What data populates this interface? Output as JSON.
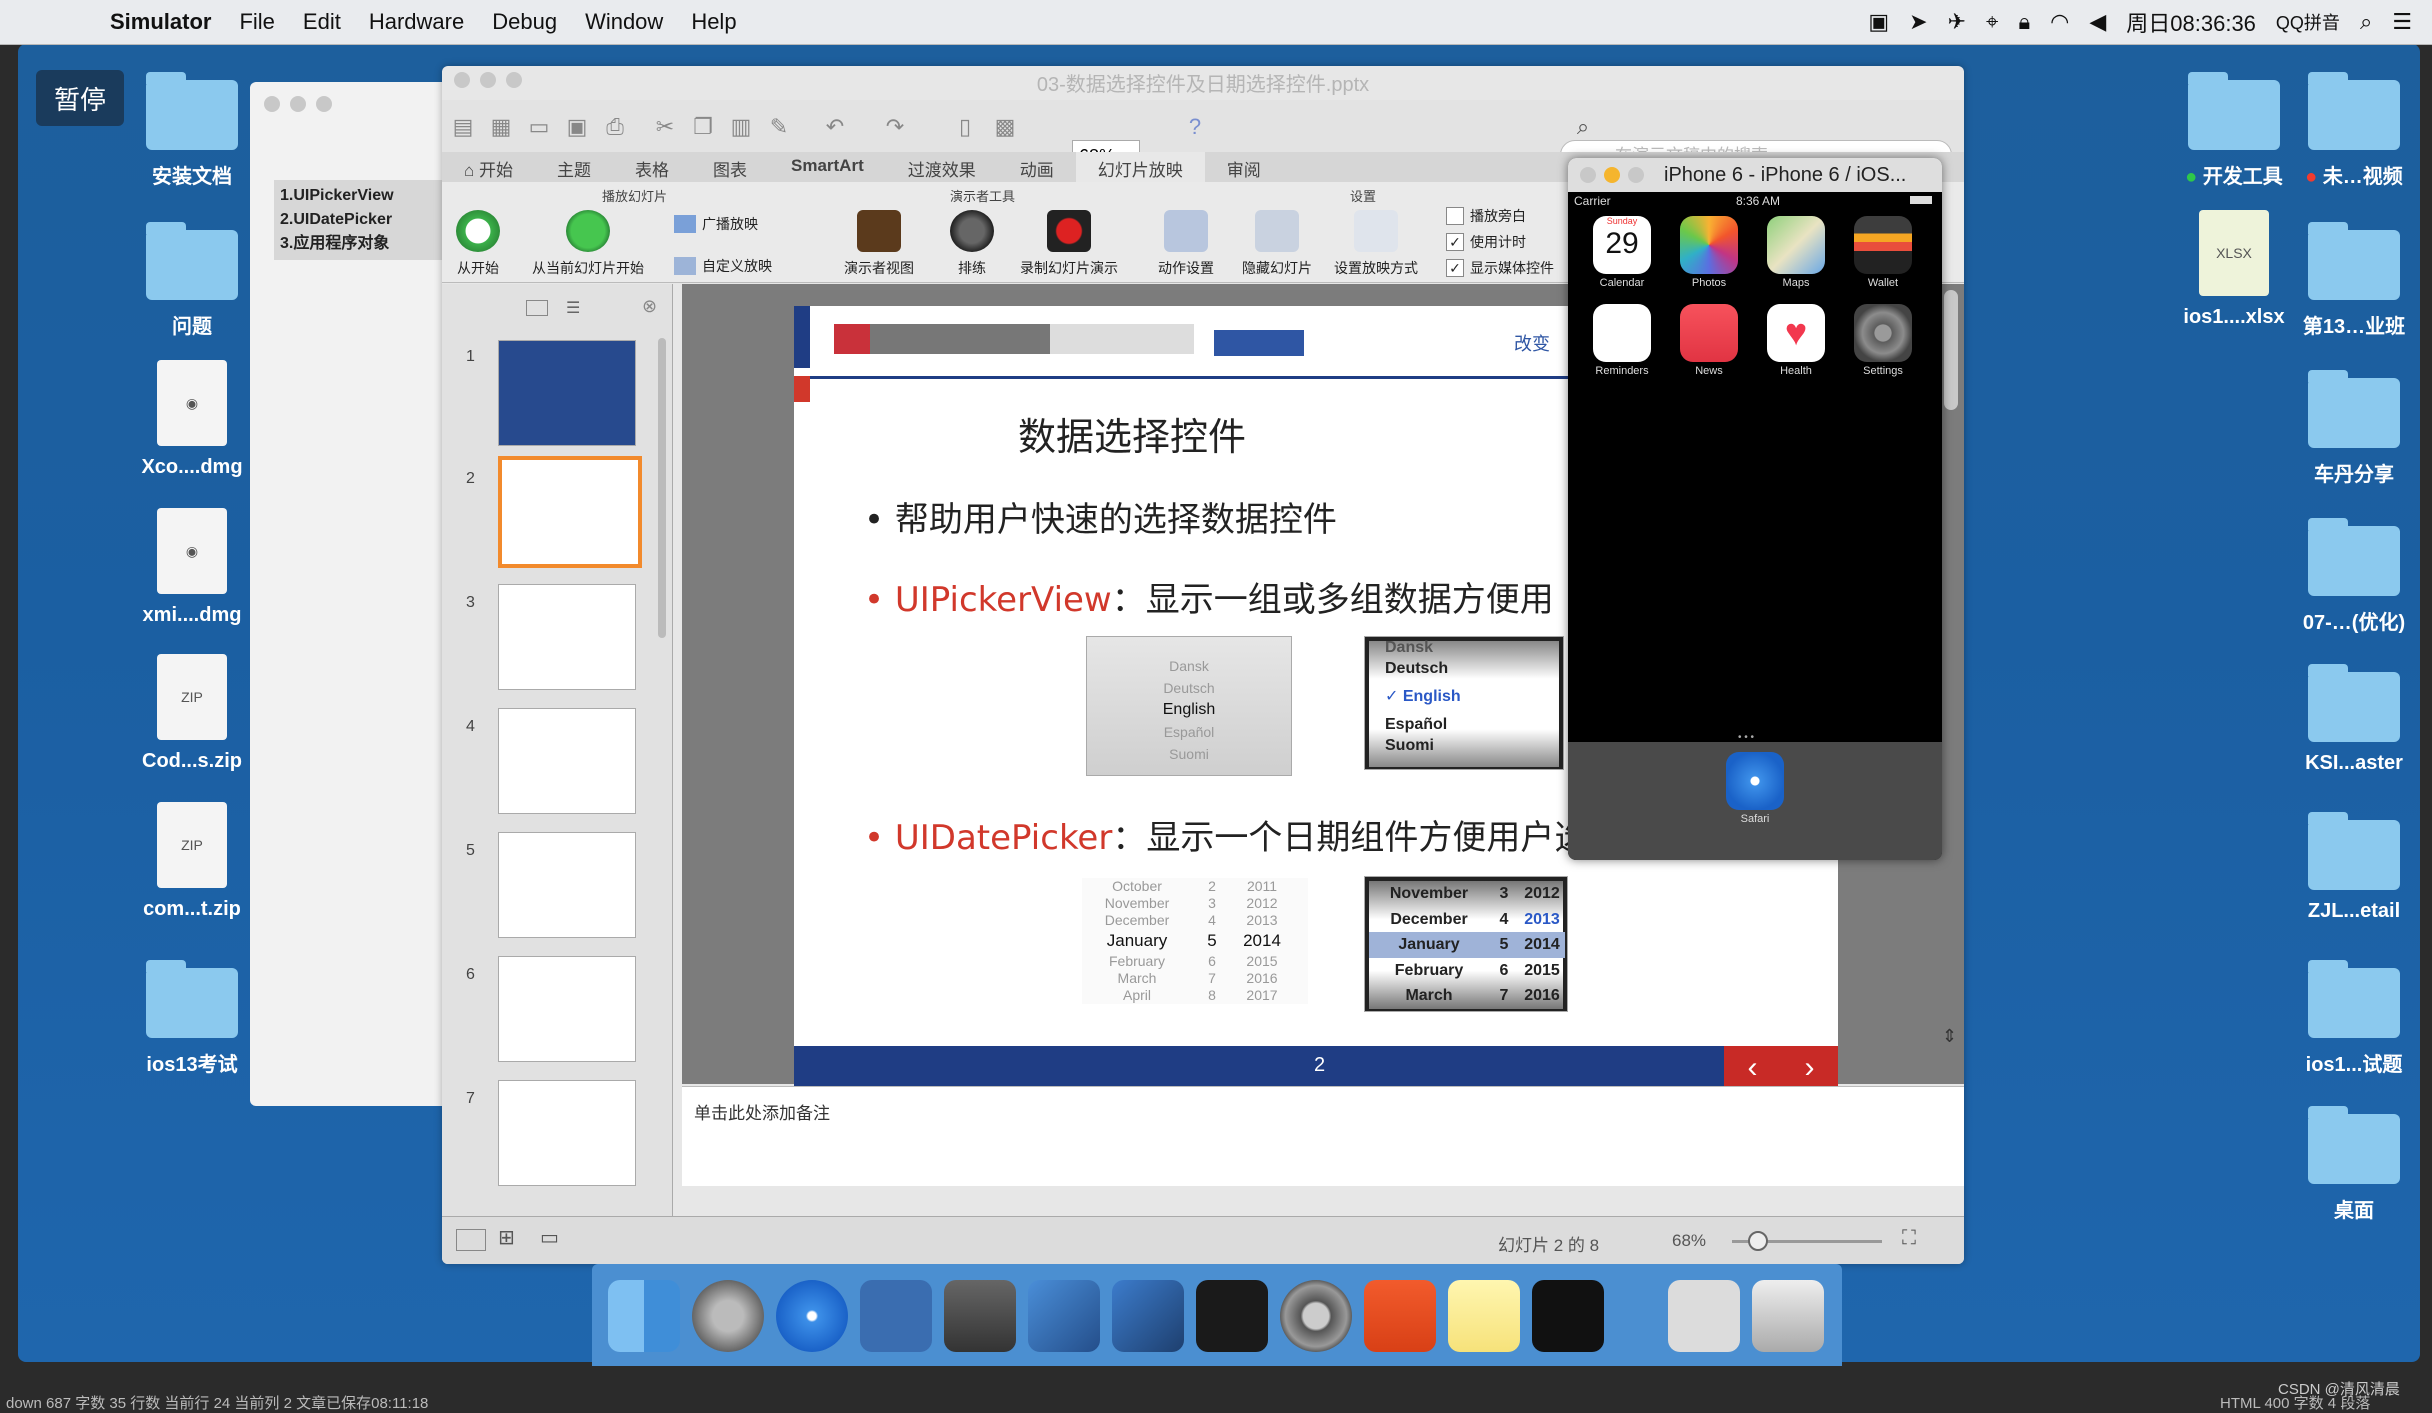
{
  "menubar": {
    "app": "Simulator",
    "items": [
      "File",
      "Edit",
      "Hardware",
      "Debug",
      "Window",
      "Help"
    ],
    "clock": "周日08:36:36",
    "input_method": "QQ拼音"
  },
  "pause_button": "暂停",
  "desktop_left": [
    {
      "label": "安装文档",
      "kind": "folder"
    },
    {
      "label": "问题",
      "kind": "folder"
    },
    {
      "label": "Xco....dmg",
      "kind": "dmg"
    },
    {
      "label": "xmi....dmg",
      "kind": "dmg"
    },
    {
      "label": "Cod...s.zip",
      "kind": "zip"
    },
    {
      "label": "com...t.zip",
      "kind": "zip"
    },
    {
      "label": "ios13考试",
      "kind": "folder"
    }
  ],
  "desktop_right": [
    {
      "label": "开发工具",
      "kind": "folder",
      "tag": "green"
    },
    {
      "label": "未…视频",
      "kind": "folder",
      "tag": "red"
    },
    {
      "label": "ios1....xlsx",
      "kind": "xlsx"
    },
    {
      "label": "第13…业班",
      "kind": "folder"
    },
    {
      "label": "车丹分享",
      "kind": "folder"
    },
    {
      "label": "07-…(优化)",
      "kind": "folder"
    },
    {
      "label": "KSI...aster",
      "kind": "folder"
    },
    {
      "label": "ZJL...etail",
      "kind": "folder"
    },
    {
      "label": "ios1...试题",
      "kind": "folder"
    },
    {
      "label": "桌面",
      "kind": "folder"
    }
  ],
  "bg_window": {
    "lines": [
      "1.UIPickerView",
      "2.UIDatePicker",
      "3.应用程序对象"
    ]
  },
  "ppt": {
    "title": "03-数据选择控件及日期选择控件.pptx",
    "zoom": "68%",
    "search_placeholder": "在演示文稿中的搜索",
    "tabs": [
      "开始",
      "主题",
      "表格",
      "图表",
      "SmartArt",
      "过渡效果",
      "动画",
      "幻灯片放映",
      "审阅"
    ],
    "active_tab": "幻灯片放映",
    "ribbon_groups": [
      "播放幻灯片",
      "演示者工具",
      "设置"
    ],
    "ribbon_buttons": [
      "从开始",
      "从当前幻灯片开始",
      "广播放映",
      "自定义放映",
      "演示者视图",
      "排练",
      "录制幻灯片演示",
      "动作设置",
      "隐藏幻灯片",
      "设置放映方式"
    ],
    "checkboxes": [
      {
        "label": "播放旁白",
        "checked": false
      },
      {
        "label": "使用计时",
        "checked": true
      },
      {
        "label": "显示媒体控件",
        "checked": true
      }
    ],
    "thumb_numbers": [
      "1",
      "2",
      "3",
      "4",
      "5",
      "6",
      "7"
    ],
    "selected_slide": 2,
    "notes_placeholder": "单击此处添加备注",
    "status_slide": "幻灯片 2 的 8",
    "status_zoom": "68%"
  },
  "slide": {
    "header_link": "改变",
    "title": "数据选择控件",
    "bullet1": "帮助用户快速的选择数据控件",
    "bullet2_name": "UIPickerView",
    "bullet2_desc": "：显示一组或多组数据方便用",
    "bullet3_name": "UIDatePicker",
    "bullet3_desc": "：显示一个日期组件方便用户选择",
    "picker1": [
      "Dansk",
      "Deutsch",
      "English",
      "Español",
      "Suomi"
    ],
    "picker2": [
      "Dansk",
      "Deutsch",
      "✓ English",
      "Español",
      "Suomi"
    ],
    "date1": [
      [
        "October",
        "2",
        "2011"
      ],
      [
        "November",
        "3",
        "2012"
      ],
      [
        "December",
        "4",
        "2013"
      ],
      [
        "January",
        "5",
        "2014"
      ],
      [
        "February",
        "6",
        "2015"
      ],
      [
        "March",
        "7",
        "2016"
      ],
      [
        "April",
        "8",
        "2017"
      ]
    ],
    "date2": [
      [
        "November",
        "3",
        "2012"
      ],
      [
        "December",
        "4",
        "2013"
      ],
      [
        "January",
        "5",
        "2014"
      ],
      [
        "February",
        "6",
        "2015"
      ],
      [
        "March",
        "7",
        "2016"
      ]
    ],
    "page_number": "2"
  },
  "simulator": {
    "title": "iPhone 6 - iPhone 6 / iOS...",
    "carrier": "Carrier",
    "time": "8:36 AM",
    "calendar_day": "Sunday",
    "calendar_date": "29",
    "apps_row1": [
      "Calendar",
      "Photos",
      "Maps",
      "Wallet"
    ],
    "apps_row2": [
      "Reminders",
      "News",
      "Health",
      "Settings"
    ],
    "dock_app": "Safari"
  },
  "bottom_text_left": "down 687 字数 35 行数 当前行 24 当前列 2 文章已保存08:11:18",
  "bottom_text_right": "HTML 400 字数 4 段落",
  "watermark": "CSDN @清风清晨"
}
